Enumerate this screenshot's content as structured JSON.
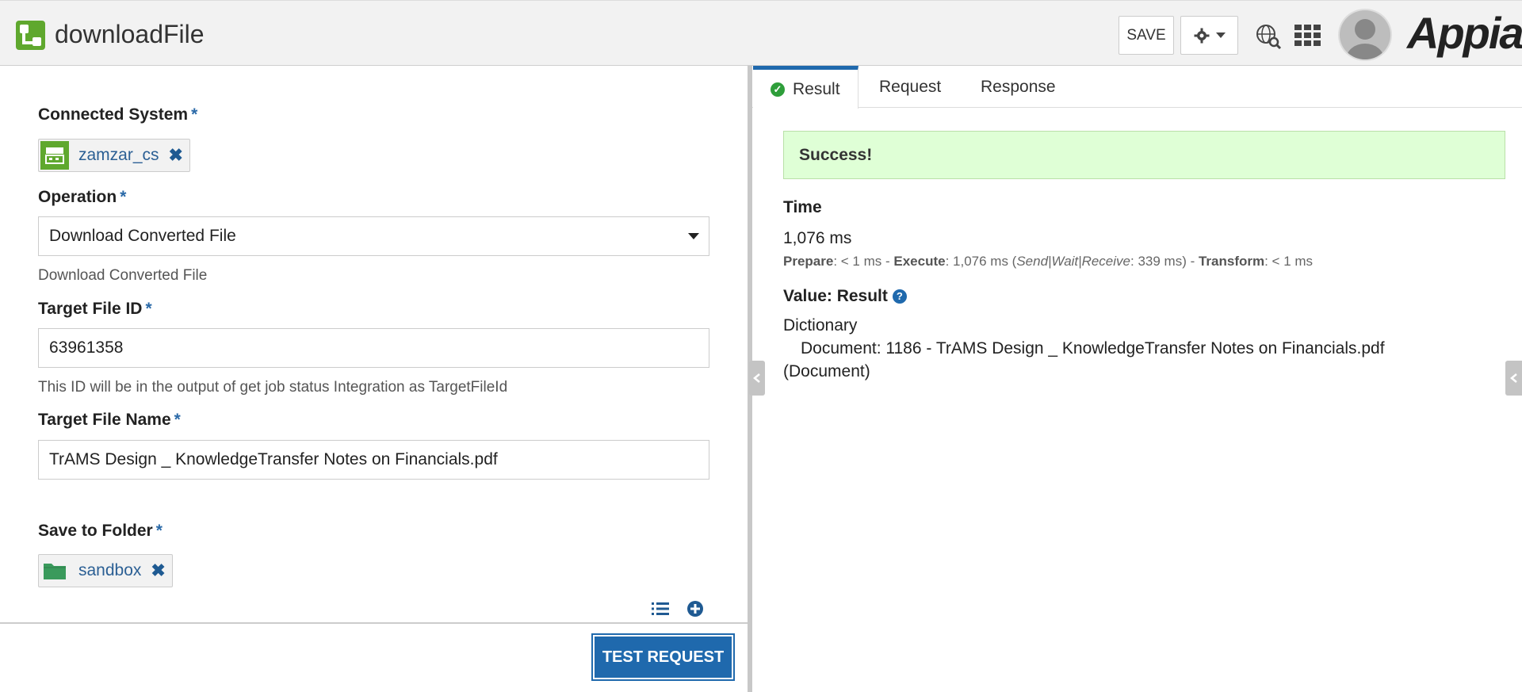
{
  "header": {
    "title": "downloadFile",
    "save_label": "SAVE",
    "logo": "Appian",
    "icons": [
      "app-icon",
      "gear-icon",
      "globe-search-icon",
      "app-grid-icon",
      "avatar"
    ]
  },
  "form": {
    "connected_system": {
      "label": "Connected System",
      "required": "*",
      "value": "zamzar_cs"
    },
    "operation": {
      "label": "Operation",
      "required": "*",
      "value": "Download Converted File",
      "help": "Download Converted File"
    },
    "target_file_id": {
      "label": "Target File ID",
      "required": "*",
      "value": "63961358",
      "help": "This ID will be in the output of get job status Integration as TargetFileId"
    },
    "target_file_name": {
      "label": "Target File Name",
      "required": "*",
      "value": "TrAMS Design _ KnowledgeTransfer Notes on Financials.pdf"
    },
    "save_to_folder": {
      "label": "Save to Folder",
      "required": "*",
      "value": "sandbox"
    },
    "remove_glyph": "✖",
    "test_button": "TEST REQUEST"
  },
  "tabs": [
    {
      "label": "Result"
    },
    {
      "label": "Request"
    },
    {
      "label": "Response"
    }
  ],
  "result": {
    "status": "Success!",
    "time_label": "Time",
    "time_value": "1,076 ms",
    "prepare_label": "Prepare",
    "prepare_value": ": < 1 ms - ",
    "execute_label": "Execute",
    "execute_value": ": 1,076 ms (",
    "send_wait_receive": "Send|Wait|Receive",
    "swr_value": ": 339 ms) - ",
    "transform_label": "Transform",
    "transform_value": ": < 1 ms",
    "value_label": "Value: Result",
    "value_line1": "Dictionary",
    "value_line2": "Document: 1186 - TrAMS Design _ KnowledgeTransfer Notes on Financials.pdf",
    "value_line3": "(Document)"
  },
  "colors": {
    "accent": "#1f69ad",
    "success_bg": "#dfffd6",
    "app_green": "#5fa82e",
    "folder_green": "#3a9a5c"
  }
}
